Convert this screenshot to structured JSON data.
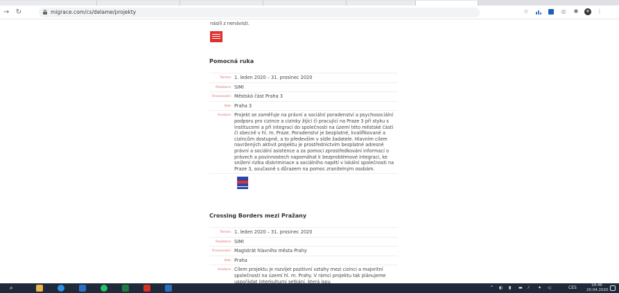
{
  "browser": {
    "url": "migrace.com/cs/delame/projekty"
  },
  "page": {
    "prev_snippet": "násilí z nenávisti.",
    "projects": [
      {
        "title": "Pomocná ruka",
        "termin_label": "Termín:",
        "termin": "1. leden 2020 – 31. prosinec 2020",
        "realizace_label": "Realizace:",
        "realizace": "SIMI",
        "financovani_label": "Financování:",
        "financovani": "Městská část Praha 3",
        "kde_label": "Kde:",
        "kde": "Praha 3",
        "anotace_label": "Anotace:",
        "anotace": "Projekt se zaměřuje na právní a sociální poradenství a psychosociální podporu pro cizince a cizinky žijící či pracující na Praze 3 při styku s institucemi a při integraci do společnosti na území této městské části či obecně v hl. m. Praze. Poradenství je bezplatné, kvalifikované a cizincům dostupné, a to především v sídle žadatele. Hlavním cílem navržených aktivit projektu je prostřednictvím bezplatné adresné právní a sociální asistence a za pomoci zprostředkování informací o právech a povinnostech napomáhat k bezproblémové integraci, ke snížení rizika diskriminace a sociálního napětí v lokální společnosti na Praze 3, současně s důrazem na pomoc zranitelným osobám."
      },
      {
        "title": "Crossing Borders mezi Pražany",
        "termin_label": "Termín:",
        "termin": "1. leden 2020 – 31. prosinec 2020",
        "realizace_label": "Realizace:",
        "realizace": "SIMI",
        "financovani_label": "Financování:",
        "financovani": "Magistrát hlavního města Prahy",
        "kde_label": "Kde:",
        "kde": "Praha",
        "anotace_label": "Anotace:",
        "anotace": "Cílem projektu je rozvíjet pozitivní vztahy mezi cizinci a majoritní společností na území hl. m. Prahy. V rámci projektu tak plánujeme uspořádat interkulturní setkání, která jsou"
      }
    ]
  },
  "taskbar": {
    "lang": "CES",
    "time": "14:46",
    "date": "20.04.2020"
  },
  "colors": {
    "label_red": "#d86a6a",
    "taskbar": "#1e2a3a"
  }
}
